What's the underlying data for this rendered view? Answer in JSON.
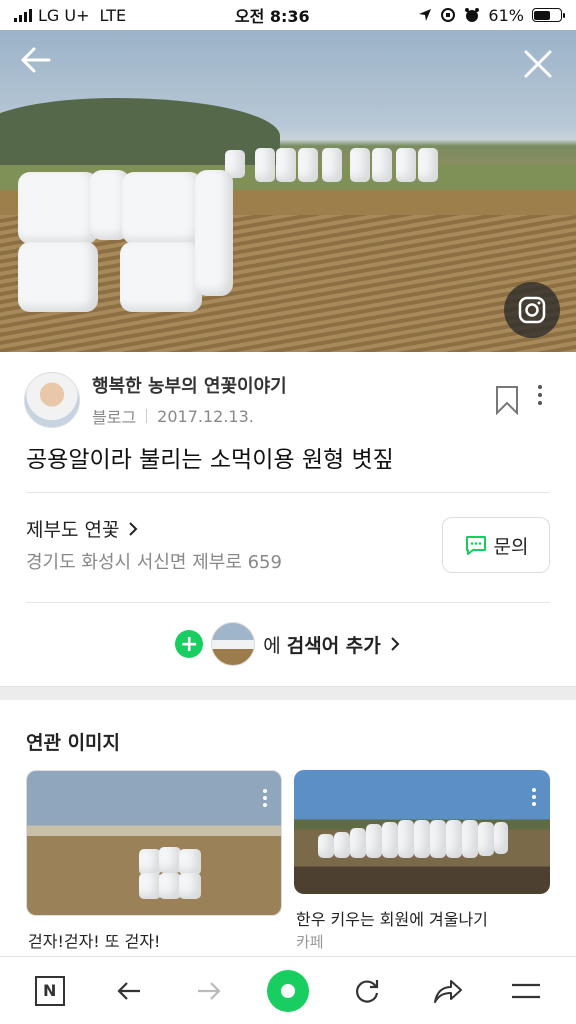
{
  "status_bar": {
    "carrier": "LG U+",
    "network": "LTE",
    "time": "오전 8:36",
    "battery": "61%",
    "battery_level": 0.61
  },
  "hero": {
    "back_icon": "arrow-left-icon",
    "close_icon": "close-icon",
    "lens_icon": "camera-lens-icon"
  },
  "post": {
    "author_name": "행복한 농부의 연꽃이야기",
    "source": "블로그",
    "date": "2017.12.13.",
    "title": "공용알이라 불리는 소먹이용 원형 볏짚"
  },
  "place": {
    "name": "제부도 연꽃",
    "address": "경기도 화성시 서신면 제부로 659",
    "inquiry_label": "문의"
  },
  "add_keyword": {
    "prefix": "에",
    "label": "검색어 추가"
  },
  "related": {
    "title": "연관 이미지",
    "cards": [
      {
        "caption": "걷자!걷자! 또 걷자!",
        "sub": ""
      },
      {
        "caption": "한우 키우는 회원에 겨울나기",
        "sub": "카페"
      }
    ]
  },
  "bottom_nav": {
    "items": [
      "naver-icon",
      "back-arrow-icon",
      "forward-arrow-icon",
      "home-green-icon",
      "refresh-icon",
      "share-icon",
      "menu-icon"
    ]
  },
  "colors": {
    "accent": "#19ce60"
  }
}
